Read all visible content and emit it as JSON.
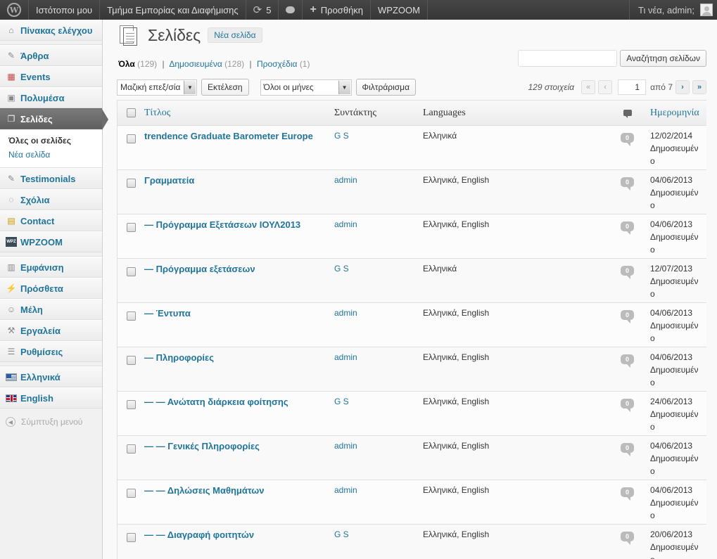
{
  "adminbar": {
    "my_sites": "Ιστότοποι μου",
    "site_name": "Τμήμα Εμπορίας και Διαφήμισης",
    "updates_count": "5",
    "add_new": "Προσθήκη",
    "wpzoom": "WPZOOM",
    "greeting": "Τι νέα, admin;"
  },
  "sidebar": {
    "items": [
      {
        "label": "Πίνακας ελέγχου",
        "icon": "home-icon"
      },
      {
        "label": "Άρθρα",
        "icon": "pin-icon"
      },
      {
        "label": "Events",
        "icon": "calendar-icon"
      },
      {
        "label": "Πολυμέσα",
        "icon": "media-icon"
      },
      {
        "label": "Σελίδες",
        "icon": "pages-icon"
      },
      {
        "label": "Testimonials",
        "icon": "pin-icon"
      },
      {
        "label": "Σχόλια",
        "icon": "comment-icon"
      },
      {
        "label": "Contact",
        "icon": "contact-icon"
      },
      {
        "label": "WPZOOM",
        "icon": "wpzoom-icon"
      },
      {
        "label": "Εμφάνιση",
        "icon": "appearance-icon"
      },
      {
        "label": "Πρόσθετα",
        "icon": "plugin-icon"
      },
      {
        "label": "Μέλη",
        "icon": "users-icon"
      },
      {
        "label": "Εργαλεία",
        "icon": "tools-icon"
      },
      {
        "label": "Ρυθμίσεις",
        "icon": "settings-icon"
      },
      {
        "label": "Ελληνικά",
        "icon": "greek-flag-icon"
      },
      {
        "label": "English",
        "icon": "uk-flag-icon"
      }
    ],
    "submenu": {
      "all_pages": "Όλες οι σελίδες",
      "new_page": "Νέα σελίδα"
    },
    "collapse": "Σύμπτυξη μενού"
  },
  "header": {
    "title": "Σελίδες",
    "add_new": "Νέα σελίδα"
  },
  "views": [
    {
      "label": "Όλα",
      "count": "(129)"
    },
    {
      "label": "Δημοσιευμένα",
      "count": "(128)"
    },
    {
      "label": "Προσχέδια",
      "count": "(1)"
    }
  ],
  "search": {
    "button": "Αναζήτηση σελίδων",
    "value": ""
  },
  "tablenav": {
    "bulk_action": "Μαζική επεξ/σία",
    "apply": "Εκτέλεση",
    "months": "Όλοι οι μήνες",
    "filter": "Φιλτράρισμα",
    "items_count": "129 στοιχεία",
    "current_page": "1",
    "of_pages": "από 7",
    "first": "«",
    "prev": "‹",
    "next": "›",
    "last": "»"
  },
  "table": {
    "headers": {
      "title": "Τίτλος",
      "author": "Συντάκτης",
      "languages": "Languages",
      "date": "Ημερομηνία"
    },
    "rows": [
      {
        "title": "trendence Graduate Barometer Europe",
        "author": "G S",
        "languages": "Ελληνικά",
        "comments": "0",
        "date": "12/02/2014",
        "status": "Δημοσιευμέν",
        "status2": "ο"
      },
      {
        "title": "Γραμματεία",
        "author": "admin",
        "languages": "Ελληνικά, English",
        "comments": "0",
        "date": "04/06/2013",
        "status": "Δημοσιευμέν",
        "status2": "ο"
      },
      {
        "title": "— Πρόγραμμα Εξετάσεων ΙΟΥΛ2013",
        "author": "admin",
        "languages": "Ελληνικά, English",
        "comments": "0",
        "date": "04/06/2013",
        "status": "Δημοσιευμέν",
        "status2": "ο"
      },
      {
        "title": "— Πρόγραμμα εξετάσεων",
        "author": "G S",
        "languages": "Ελληνικά",
        "comments": "0",
        "date": "12/07/2013",
        "status": "Δημοσιευμέν",
        "status2": "ο"
      },
      {
        "title": "— Έντυπα",
        "author": "admin",
        "languages": "Ελληνικά, English",
        "comments": "0",
        "date": "04/06/2013",
        "status": "Δημοσιευμέν",
        "status2": "ο"
      },
      {
        "title": "— Πληροφορίες",
        "author": "admin",
        "languages": "Ελληνικά, English",
        "comments": "0",
        "date": "04/06/2013",
        "status": "Δημοσιευμέν",
        "status2": "ο"
      },
      {
        "title": "— — Ανώτατη διάρκεια φοίτησης",
        "author": "G S",
        "languages": "Ελληνικά, English",
        "comments": "0",
        "date": "24/06/2013",
        "status": "Δημοσιευμέν",
        "status2": "ο"
      },
      {
        "title": "— — Γενικές Πληροφορίες",
        "author": "admin",
        "languages": "Ελληνικά, English",
        "comments": "0",
        "date": "04/06/2013",
        "status": "Δημοσιευμέν",
        "status2": "ο"
      },
      {
        "title": "— — Δηλώσεις Μαθημάτων",
        "author": "admin",
        "languages": "Ελληνικά, English",
        "comments": "0",
        "date": "04/06/2013",
        "status": "Δημοσιευμέν",
        "status2": "ο"
      },
      {
        "title": "— — Διαγραφή φοιτητών",
        "author": "G S",
        "languages": "Ελληνικά, English",
        "comments": "0",
        "date": "20/06/2013",
        "status": "Δημοσιευμέν",
        "status2": "ο"
      }
    ]
  }
}
